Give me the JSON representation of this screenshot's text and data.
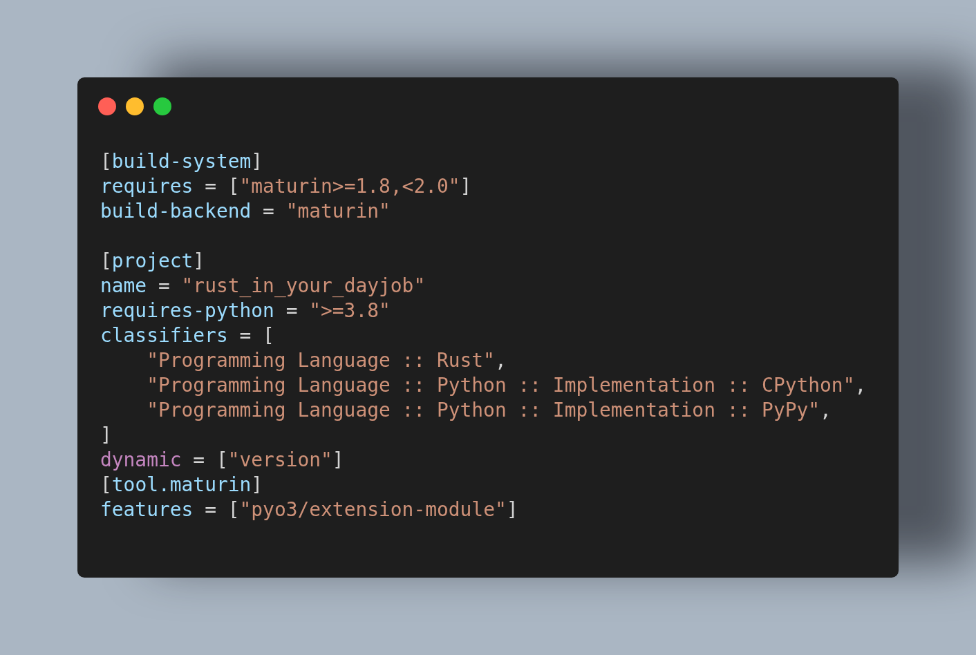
{
  "window": {
    "controls": [
      {
        "kind": "close"
      },
      {
        "kind": "minimize"
      },
      {
        "kind": "zoom"
      }
    ]
  },
  "code_lines": [
    {
      "kind": "code",
      "indent": false,
      "tokens": [
        {
          "kind": "punct",
          "t": "["
        },
        {
          "kind": "key",
          "t": "build-system"
        },
        {
          "kind": "punct",
          "t": "]"
        }
      ]
    },
    {
      "kind": "code",
      "indent": false,
      "tokens": [
        {
          "kind": "key",
          "t": "requires"
        },
        {
          "kind": "punct",
          "t": " = ["
        },
        {
          "kind": "string",
          "t": "\"maturin>=1.8,<2.0\""
        },
        {
          "kind": "punct",
          "t": "]"
        }
      ]
    },
    {
      "kind": "code",
      "indent": false,
      "tokens": [
        {
          "kind": "key",
          "t": "build-backend"
        },
        {
          "kind": "punct",
          "t": " = "
        },
        {
          "kind": "string",
          "t": "\"maturin\""
        }
      ]
    },
    {
      "kind": "blank"
    },
    {
      "kind": "code",
      "indent": false,
      "tokens": [
        {
          "kind": "punct",
          "t": "["
        },
        {
          "kind": "key",
          "t": "project"
        },
        {
          "kind": "punct",
          "t": "]"
        }
      ]
    },
    {
      "kind": "code",
      "indent": false,
      "tokens": [
        {
          "kind": "key",
          "t": "name"
        },
        {
          "kind": "punct",
          "t": " = "
        },
        {
          "kind": "string",
          "t": "\"rust_in_your_dayjob\""
        }
      ]
    },
    {
      "kind": "code",
      "indent": false,
      "tokens": [
        {
          "kind": "key",
          "t": "requires-python"
        },
        {
          "kind": "punct",
          "t": " = "
        },
        {
          "kind": "string",
          "t": "\">=3.8\""
        }
      ]
    },
    {
      "kind": "code",
      "indent": false,
      "tokens": [
        {
          "kind": "key",
          "t": "classifiers"
        },
        {
          "kind": "punct",
          "t": " = ["
        }
      ]
    },
    {
      "kind": "code",
      "indent": true,
      "tokens": [
        {
          "kind": "string",
          "t": "\"Programming Language :: Rust\""
        },
        {
          "kind": "punct",
          "t": ","
        }
      ]
    },
    {
      "kind": "code",
      "indent": true,
      "tokens": [
        {
          "kind": "string",
          "t": "\"Programming Language :: Python :: Implementation :: CPython\""
        },
        {
          "kind": "punct",
          "t": ","
        }
      ]
    },
    {
      "kind": "code",
      "indent": true,
      "tokens": [
        {
          "kind": "string",
          "t": "\"Programming Language :: Python :: Implementation :: PyPy\""
        },
        {
          "kind": "punct",
          "t": ","
        }
      ]
    },
    {
      "kind": "code",
      "indent": false,
      "tokens": [
        {
          "kind": "punct",
          "t": "]"
        }
      ]
    },
    {
      "kind": "code",
      "indent": false,
      "tokens": [
        {
          "kind": "keyword",
          "t": "dynamic"
        },
        {
          "kind": "punct",
          "t": " = ["
        },
        {
          "kind": "string",
          "t": "\"version\""
        },
        {
          "kind": "punct",
          "t": "]"
        }
      ]
    },
    {
      "kind": "code",
      "indent": false,
      "tokens": [
        {
          "kind": "punct",
          "t": "["
        },
        {
          "kind": "key",
          "t": "tool.maturin"
        },
        {
          "kind": "punct",
          "t": "]"
        }
      ]
    },
    {
      "kind": "code",
      "indent": false,
      "tokens": [
        {
          "kind": "key",
          "t": "features"
        },
        {
          "kind": "punct",
          "t": " = ["
        },
        {
          "kind": "string",
          "t": "\"pyo3/extension-module\""
        },
        {
          "kind": "punct",
          "t": "]"
        }
      ]
    }
  ]
}
